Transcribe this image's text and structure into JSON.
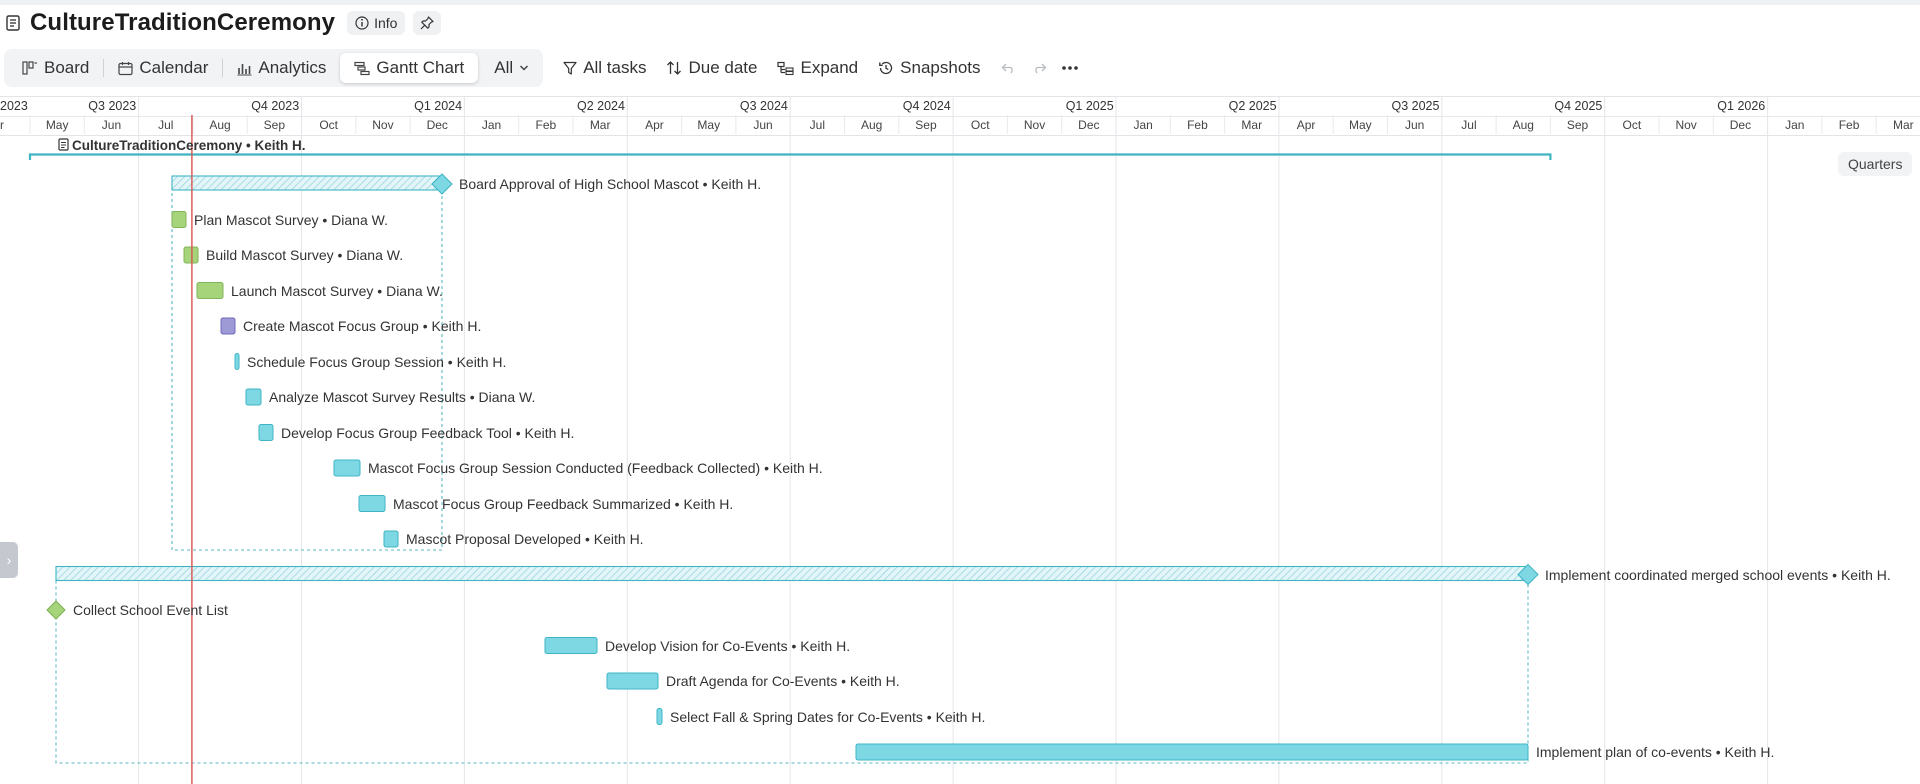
{
  "header": {
    "title": "CultureTraditionCeremony",
    "info_label": "Info"
  },
  "toolbar": {
    "views": [
      {
        "label": "Board",
        "icon": "board-icon"
      },
      {
        "label": "Calendar",
        "icon": "calendar-icon"
      },
      {
        "label": "Analytics",
        "icon": "analytics-icon"
      },
      {
        "label": "Gantt Chart",
        "icon": "gantt-icon",
        "active": true
      },
      {
        "label": "All",
        "icon": "chevron-down-icon"
      }
    ],
    "filter_label": "All tasks",
    "sort_label": "Due date",
    "expand_label": "Expand",
    "snapshots_label": "Snapshots"
  },
  "timeline": {
    "quarters": [
      "2023",
      "Q3 2023",
      "Q4 2023",
      "Q1 2024",
      "Q2 2024",
      "Q3 2024",
      "Q4 2024",
      "Q1 2025",
      "Q2 2025",
      "Q3 2025",
      "Q4 2025",
      "Q1 2026"
    ],
    "months": [
      "r",
      "May",
      "Jun",
      "Jul",
      "Aug",
      "Sep",
      "Oct",
      "Nov",
      "Dec",
      "Jan",
      "Feb",
      "Mar",
      "Apr",
      "May",
      "Jun",
      "Jul",
      "Aug",
      "Sep",
      "Oct",
      "Nov",
      "Dec",
      "Jan",
      "Feb",
      "Mar",
      "Apr",
      "May",
      "Jun",
      "Jul",
      "Aug",
      "Sep",
      "Oct",
      "Nov",
      "Dec",
      "Jan",
      "Feb",
      "Mar"
    ],
    "scale_button": "Quarters"
  },
  "colors": {
    "cyan": "#7ed8e3",
    "cyan_border": "#3fb5c4",
    "green": "#a6d47a",
    "purple": "#9d9ad6",
    "today_line": "#d9534f"
  },
  "project": {
    "label": "CultureTraditionCeremony • Keith H."
  },
  "tasks": [
    {
      "label": "Board Approval of High School Mascot • Keith H.",
      "start": "2023-07",
      "end": "2023-12",
      "kind": "group"
    },
    {
      "label": "Plan Mascot Survey • Diana W.",
      "start": "2023-07",
      "end": "2023-07",
      "kind": "green"
    },
    {
      "label": "Build Mascot Survey • Diana W.",
      "start": "2023-08",
      "end": "2023-08",
      "kind": "green"
    },
    {
      "label": "Launch Mascot Survey • Diana W.",
      "start": "2023-08",
      "end": "2023-08",
      "kind": "green"
    },
    {
      "label": "Create Mascot Focus Group • Keith H.",
      "start": "2023-08",
      "end": "2023-08",
      "kind": "purple"
    },
    {
      "label": "Schedule Focus Group Session • Keith H.",
      "start": "2023-09",
      "end": "2023-09",
      "kind": "cyan"
    },
    {
      "label": "Analyze Mascot Survey Results • Diana W.",
      "start": "2023-09",
      "end": "2023-09",
      "kind": "cyan"
    },
    {
      "label": "Develop Focus Group Feedback Tool • Keith H.",
      "start": "2023-09",
      "end": "2023-09",
      "kind": "cyan"
    },
    {
      "label": "Mascot Focus Group Session Conducted (Feedback Collected) • Keith H.",
      "start": "2023-10",
      "end": "2023-11",
      "kind": "cyan"
    },
    {
      "label": "Mascot Focus Group Feedback Summarized • Keith H.",
      "start": "2023-11",
      "end": "2023-11",
      "kind": "cyan"
    },
    {
      "label": "Mascot Proposal Developed • Keith H.",
      "start": "2023-11",
      "end": "2023-11",
      "kind": "cyan"
    },
    {
      "label": "Implement coordinated merged school events • Keith H.",
      "start": "2023-05",
      "end": "2025-08",
      "kind": "group"
    },
    {
      "label": "Collect School Event List",
      "start": "2023-05",
      "end": "2023-05",
      "kind": "milestone"
    },
    {
      "label": "Develop Vision for Co-Events • Keith H.",
      "start": "2024-03",
      "end": "2024-03",
      "kind": "cyan"
    },
    {
      "label": "Draft Agenda for Co-Events • Keith H.",
      "start": "2024-04",
      "end": "2024-04",
      "kind": "cyan"
    },
    {
      "label": "Select Fall & Spring Dates for Co-Events • Keith H.",
      "start": "2024-05",
      "end": "2024-05",
      "kind": "cyan"
    },
    {
      "label": "Implement plan of co-events • Keith H.",
      "start": "2024-09",
      "end": "2025-08",
      "kind": "cyan"
    }
  ]
}
